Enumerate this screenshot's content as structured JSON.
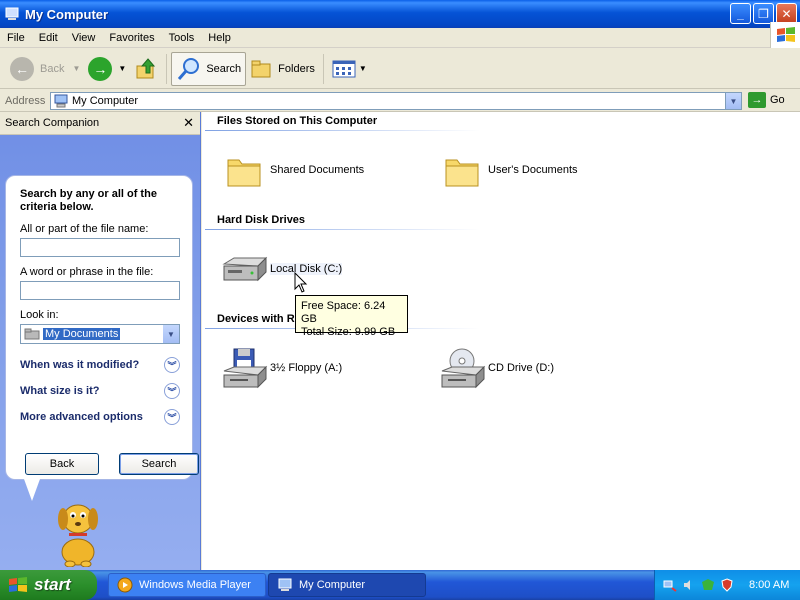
{
  "window": {
    "title": "My Computer"
  },
  "menu": [
    "File",
    "Edit",
    "View",
    "Favorites",
    "Tools",
    "Help"
  ],
  "toolbar": {
    "back": "Back",
    "search": "Search",
    "folders": "Folders"
  },
  "address": {
    "label": "Address",
    "value": "My Computer",
    "go": "Go"
  },
  "search_pane": {
    "title": "Search Companion",
    "heading": "Search by any or all of the criteria below.",
    "file_name_label": "All or part of the file name:",
    "phrase_label": "A word or phrase in the file:",
    "look_in_label": "Look in:",
    "look_in_value": "My Documents",
    "options": [
      "When was it modified?",
      "What size is it?",
      "More advanced options"
    ],
    "back_button": "Back",
    "search_button": "Search"
  },
  "content": {
    "sections": {
      "files": "Files Stored on This Computer",
      "drives": "Hard Disk Drives",
      "devices": "Devices with R"
    },
    "items": {
      "shared_docs": "Shared Documents",
      "user_docs": "User's Documents",
      "local_disk": "Local Disk (C:)",
      "floppy": "3½ Floppy (A:)",
      "cd": "CD Drive (D:)"
    },
    "tooltip": {
      "free": "Free Space: 6.24 GB",
      "total": "Total Size: 9.99 GB"
    }
  },
  "taskbar": {
    "start": "start",
    "tasks": [
      "Windows Media Player",
      "My Computer"
    ],
    "clock": "8:00 AM"
  }
}
